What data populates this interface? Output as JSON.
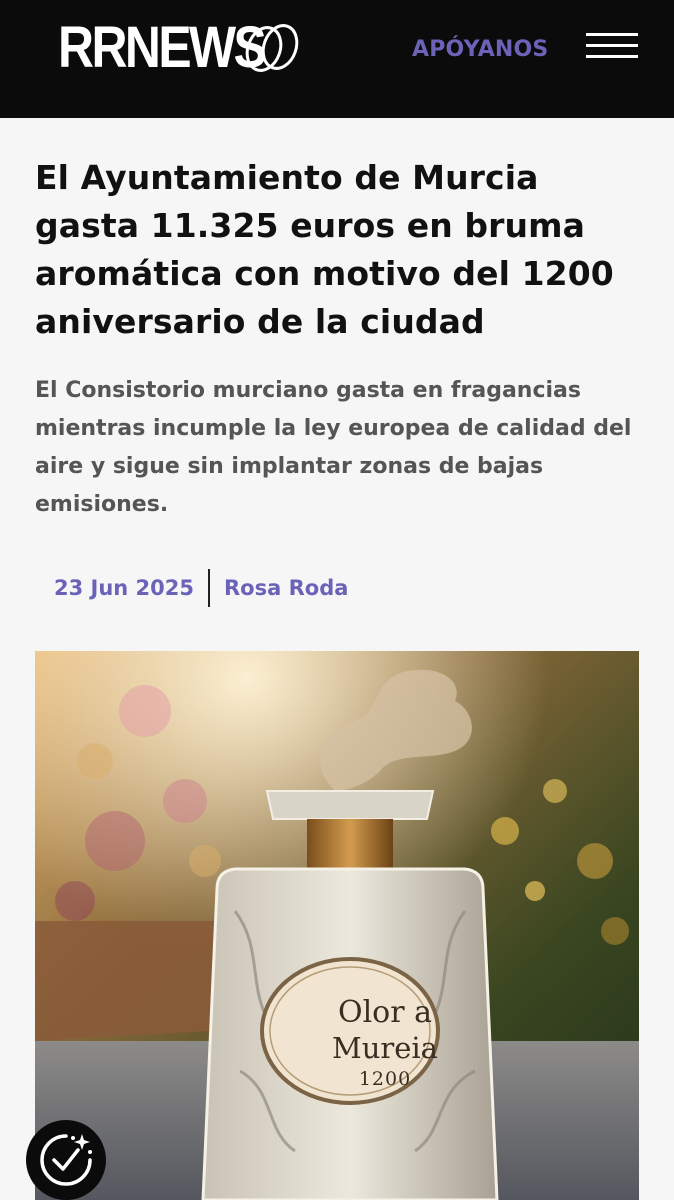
{
  "header": {
    "logo_text": "RRNEWS",
    "support_label": "APÓYANOS",
    "menu_icon": "hamburger-menu-icon"
  },
  "article": {
    "headline": "El Ayuntamiento de Murcia gasta 11.325 euros en bruma aromática con motivo del 1200 aniversario de la ciudad",
    "subtitle": "El Consistorio murciano gasta en fragancias mientras incumple la ley europea de calidad del aire y sigue sin implantar zonas de bajas emisiones.",
    "date": "23 Jun 2025",
    "author": "Rosa Roda"
  },
  "hero_image": {
    "label_line1": "Olor a",
    "label_line2": "Mureia",
    "label_line3": "1200"
  },
  "floating_button": {
    "icon": "accessibility-sparkle-icon"
  },
  "colors": {
    "header_bg": "#0b0b0b",
    "accent": "#6b63b8",
    "page_bg": "#f6f6f6",
    "headline_text": "#111111",
    "subtitle_text": "#555555"
  }
}
